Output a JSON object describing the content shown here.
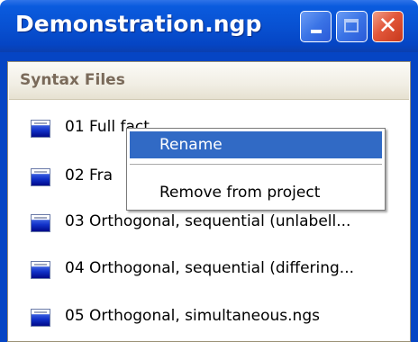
{
  "window": {
    "title": "Demonstration.ngp",
    "buttons": {
      "minimize": "minimize",
      "maximize": "maximize",
      "close": "close"
    }
  },
  "panel": {
    "header": "Syntax Files",
    "items": [
      {
        "label": "01 Full fact",
        "icon": "syntax-file-icon"
      },
      {
        "label": "02 Fra",
        "icon": "syntax-file-icon"
      },
      {
        "label": "03 Orthogonal, sequential (unlabell...",
        "icon": "syntax-file-icon"
      },
      {
        "label": "04 Orthogonal, sequential (differing...",
        "icon": "syntax-file-icon"
      },
      {
        "label": "05 Orthogonal, simultaneous.ngs",
        "icon": "syntax-file-icon"
      }
    ]
  },
  "context_menu": {
    "items": [
      {
        "label": "Rename",
        "selected": true
      },
      {
        "label": "Remove from project",
        "selected": false
      }
    ]
  },
  "colors": {
    "titlebar": "#0851d2",
    "menu_highlight": "#316ac5",
    "header_text": "#7a6a5a"
  }
}
